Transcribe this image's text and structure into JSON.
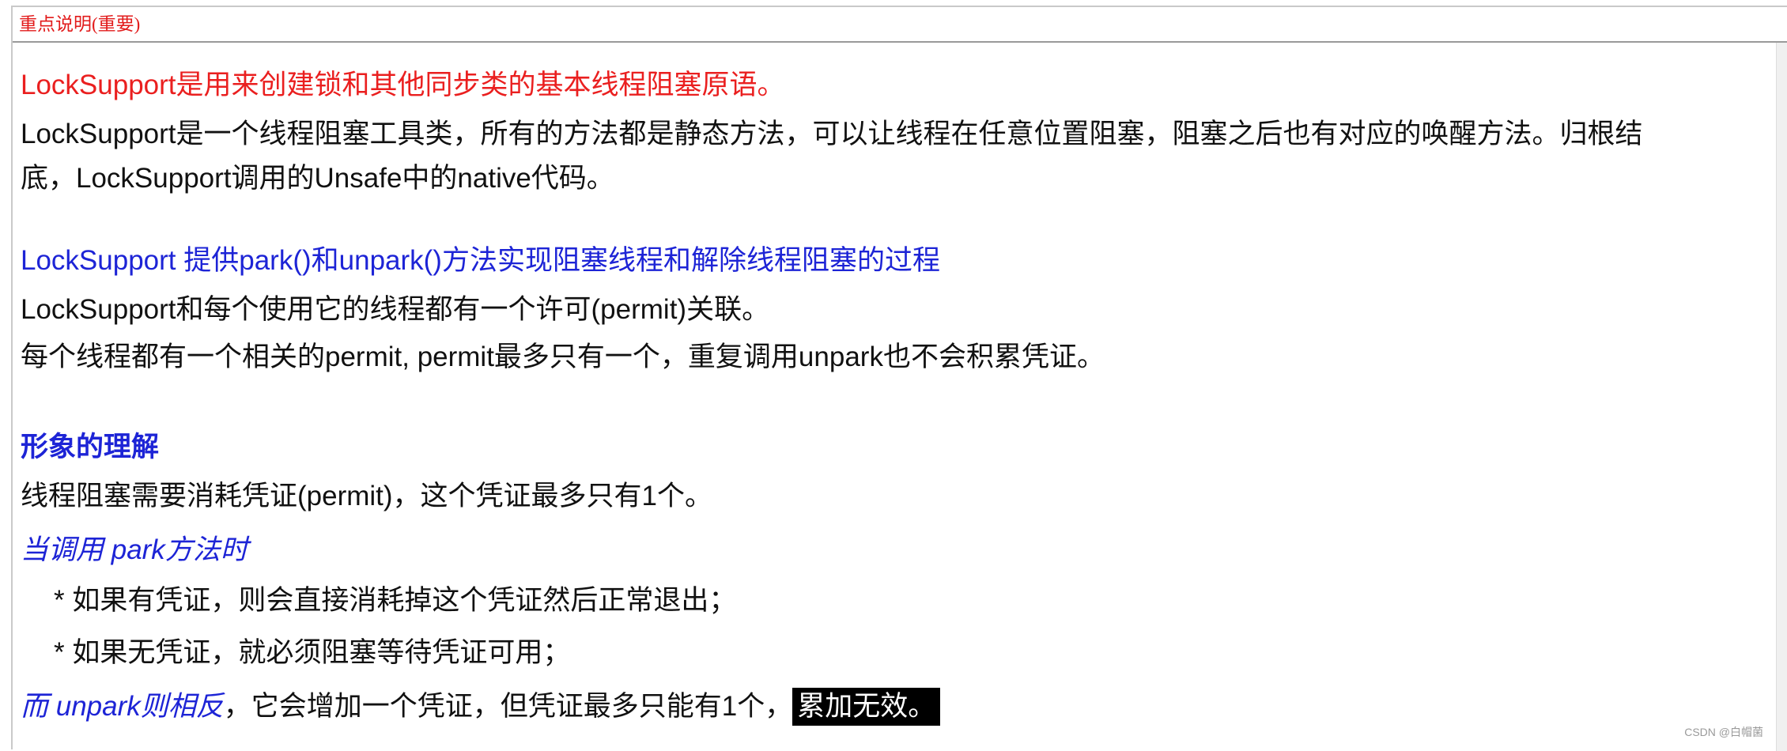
{
  "header": {
    "title": "重点说明(重要)"
  },
  "content": {
    "line1": "LockSupport是用来创建锁和其他同步类的基本线程阻塞原语。",
    "line2": "LockSupport是一个线程阻塞工具类，所有的方法都是静态方法，可以让线程在任意位置阻塞，阻塞之后也有对应的唤醒方法。归根结",
    "line3": "底，LockSupport调用的Unsafe中的native代码。",
    "line4": "LockSupport 提供park()和unpark()方法实现阻塞线程和解除线程阻塞的过程",
    "line5": "LockSupport和每个使用它的线程都有一个许可(permit)关联。",
    "line6": "每个线程都有一个相关的permit, permit最多只有一个，重复调用unpark也不会积累凭证。",
    "line7": "形象的理解",
    "line8": "线程阻塞需要消耗凭证(permit)，这个凭证最多只有1个。",
    "line9": "当调用 park方法时",
    "line10": "* 如果有凭证，则会直接消耗掉这个凭证然后正常退出；",
    "line11": "* 如果无凭证，就必须阻塞等待凭证可用；",
    "line12": {
      "italic_part": "而 unpark则相反",
      "normal_part": "，它会增加一个凭证，但凭证最多只能有1个，",
      "highlight_part": "累加无效。"
    }
  },
  "watermark": "CSDN @白帽菌",
  "colors": {
    "red": "#ea1f1f",
    "blue": "#1d24d6",
    "highlight_bg": "#000000",
    "highlight_text": "#ffffff"
  }
}
